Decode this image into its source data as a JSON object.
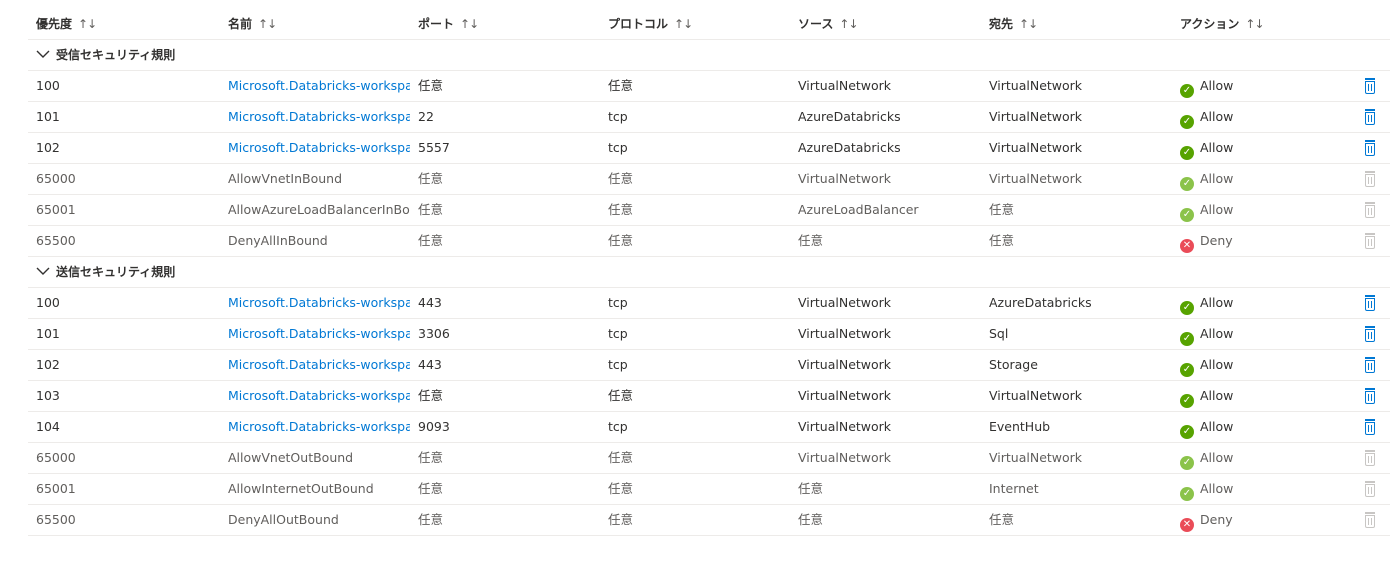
{
  "headers": {
    "priority": "優先度",
    "name": "名前",
    "port": "ポート",
    "protocol": "プロトコル",
    "source": "ソース",
    "destination": "宛先",
    "action": "アクション",
    "sort_glyph": "↑↓"
  },
  "groups": [
    {
      "label": "受信セキュリティ規則",
      "rows": [
        {
          "priority": "100",
          "name": "Microsoft.Databricks-workspa…",
          "port": "任意",
          "protocol": "任意",
          "source": "VirtualNetwork",
          "destination": "VirtualNetwork",
          "action": "Allow",
          "action_state": "allow",
          "editable": true
        },
        {
          "priority": "101",
          "name": "Microsoft.Databricks-workspa…",
          "port": "22",
          "protocol": "tcp",
          "source": "AzureDatabricks",
          "destination": "VirtualNetwork",
          "action": "Allow",
          "action_state": "allow",
          "editable": true
        },
        {
          "priority": "102",
          "name": "Microsoft.Databricks-workspa…",
          "port": "5557",
          "protocol": "tcp",
          "source": "AzureDatabricks",
          "destination": "VirtualNetwork",
          "action": "Allow",
          "action_state": "allow",
          "editable": true
        },
        {
          "priority": "65000",
          "name": "AllowVnetInBound",
          "port": "任意",
          "protocol": "任意",
          "source": "VirtualNetwork",
          "destination": "VirtualNetwork",
          "action": "Allow",
          "action_state": "allow",
          "editable": false
        },
        {
          "priority": "65001",
          "name": "AllowAzureLoadBalancerInBou…",
          "port": "任意",
          "protocol": "任意",
          "source": "AzureLoadBalancer",
          "destination": "任意",
          "action": "Allow",
          "action_state": "allow",
          "editable": false
        },
        {
          "priority": "65500",
          "name": "DenyAllInBound",
          "port": "任意",
          "protocol": "任意",
          "source": "任意",
          "destination": "任意",
          "action": "Deny",
          "action_state": "deny",
          "editable": false
        }
      ]
    },
    {
      "label": "送信セキュリティ規則",
      "rows": [
        {
          "priority": "100",
          "name": "Microsoft.Databricks-workspa…",
          "port": "443",
          "protocol": "tcp",
          "source": "VirtualNetwork",
          "destination": "AzureDatabricks",
          "action": "Allow",
          "action_state": "allow",
          "editable": true
        },
        {
          "priority": "101",
          "name": "Microsoft.Databricks-workspa…",
          "port": "3306",
          "protocol": "tcp",
          "source": "VirtualNetwork",
          "destination": "Sql",
          "action": "Allow",
          "action_state": "allow",
          "editable": true
        },
        {
          "priority": "102",
          "name": "Microsoft.Databricks-workspa…",
          "port": "443",
          "protocol": "tcp",
          "source": "VirtualNetwork",
          "destination": "Storage",
          "action": "Allow",
          "action_state": "allow",
          "editable": true
        },
        {
          "priority": "103",
          "name": "Microsoft.Databricks-workspa…",
          "port": "任意",
          "protocol": "任意",
          "source": "VirtualNetwork",
          "destination": "VirtualNetwork",
          "action": "Allow",
          "action_state": "allow",
          "editable": true
        },
        {
          "priority": "104",
          "name": "Microsoft.Databricks-workspa…",
          "port": "9093",
          "protocol": "tcp",
          "source": "VirtualNetwork",
          "destination": "EventHub",
          "action": "Allow",
          "action_state": "allow",
          "editable": true
        },
        {
          "priority": "65000",
          "name": "AllowVnetOutBound",
          "port": "任意",
          "protocol": "任意",
          "source": "VirtualNetwork",
          "destination": "VirtualNetwork",
          "action": "Allow",
          "action_state": "allow",
          "editable": false
        },
        {
          "priority": "65001",
          "name": "AllowInternetOutBound",
          "port": "任意",
          "protocol": "任意",
          "source": "任意",
          "destination": "Internet",
          "action": "Allow",
          "action_state": "allow",
          "editable": false
        },
        {
          "priority": "65500",
          "name": "DenyAllOutBound",
          "port": "任意",
          "protocol": "任意",
          "source": "任意",
          "destination": "任意",
          "action": "Deny",
          "action_state": "deny",
          "editable": false
        }
      ]
    }
  ],
  "colors": {
    "link": "#0078d4",
    "allow": "#57a300",
    "deny": "#e81123",
    "border": "#edebe9"
  },
  "icons": {
    "group_toggle": "chevron-down-icon",
    "allow": "check-circle-icon",
    "deny": "x-circle-icon",
    "delete": "trash-icon"
  }
}
